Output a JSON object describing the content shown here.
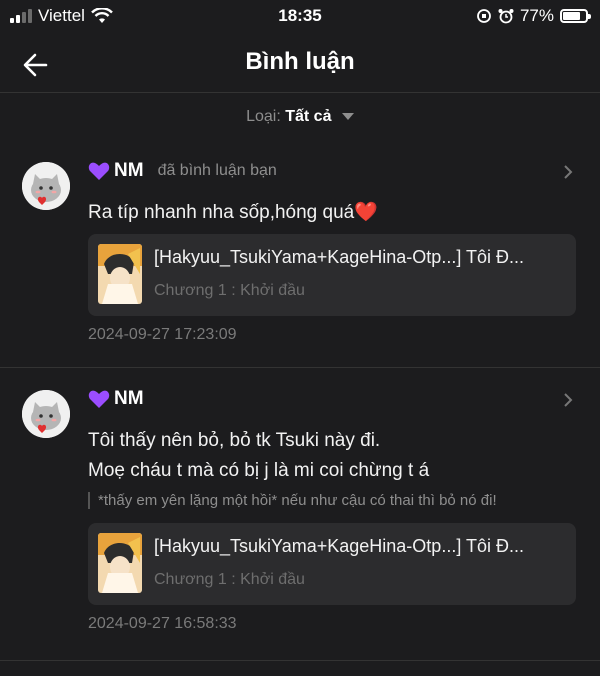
{
  "status": {
    "carrier": "Viettel",
    "time": "18:35",
    "battery": "77%",
    "battery_level": 0.77
  },
  "header": {
    "title": "Bình luận"
  },
  "filter": {
    "label": "Loại:",
    "value": "Tất cả"
  },
  "comments": [
    {
      "username": "NM",
      "action": "đã bình luận bạn",
      "text": "Ra típ nhanh nha sốp,hóng quá❤️",
      "card_title": "[Hakyuu_TsukiYama+KageHina-Otp...] Tôi Đ...",
      "card_sub": "Chương 1 : Khởi đầu",
      "time": "2024-09-27 17:23:09"
    },
    {
      "username": "NM",
      "text": "Tôi thấy nên bỏ, bỏ tk Tsuki này đi.\nMoẹ cháu t mà có bị j là mi coi chừng t á",
      "quote": "*thấy em yên lặng một hồi* nếu như cậu có thai thì bỏ nó đi!",
      "card_title": "[Hakyuu_TsukiYama+KageHina-Otp...] Tôi Đ...",
      "card_sub": "Chương 1 : Khởi đầu",
      "time": "2024-09-27 16:58:33"
    }
  ]
}
